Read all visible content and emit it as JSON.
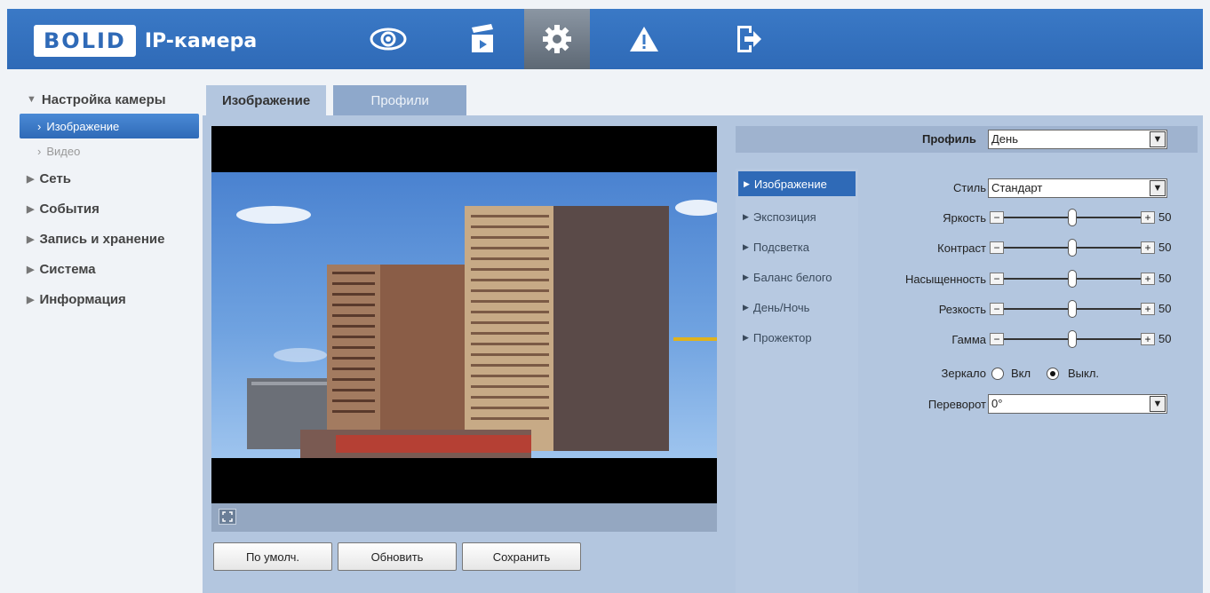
{
  "app": {
    "logo": "BOLID",
    "title": "IP-камера"
  },
  "nav": {
    "icons": [
      "eye-icon",
      "clapperboard-icon",
      "gear-icon",
      "warning-icon",
      "exit-icon"
    ],
    "active_index": 2
  },
  "sidebar": {
    "group_camera": "Настройка камеры",
    "item_image": "Изображение",
    "item_video": "Видео",
    "group_network": "Сеть",
    "group_events": "События",
    "group_record": "Запись и хранение",
    "group_system": "Система",
    "group_info": "Информация"
  },
  "tabs": {
    "image": "Изображение",
    "profiles": "Профили"
  },
  "buttons": {
    "default": "По умолч.",
    "refresh": "Обновить",
    "save": "Сохранить"
  },
  "profile": {
    "label": "Профиль",
    "value": "День"
  },
  "submenu": {
    "image": "Изображение",
    "exposure": "Экспозиция",
    "backlight": "Подсветка",
    "wb": "Баланс белого",
    "daynight": "День/Ночь",
    "projector": "Прожектор"
  },
  "settings": {
    "style_label": "Стиль",
    "style_value": "Стандарт",
    "brightness_label": "Яркость",
    "brightness_value": "50",
    "contrast_label": "Контраст",
    "contrast_value": "50",
    "saturation_label": "Насыщенность",
    "saturation_value": "50",
    "sharpness_label": "Резкость",
    "sharpness_value": "50",
    "gamma_label": "Гамма",
    "gamma_value": "50",
    "mirror_label": "Зеркало",
    "mirror_on": "Вкл",
    "mirror_off": "Выкл.",
    "mirror_selected": "off",
    "flip_label": "Переворот",
    "flip_value": "0°"
  },
  "colors": {
    "header": "#2f6ab7",
    "panel": "#b3c6df",
    "active": "#2f6ab7"
  }
}
